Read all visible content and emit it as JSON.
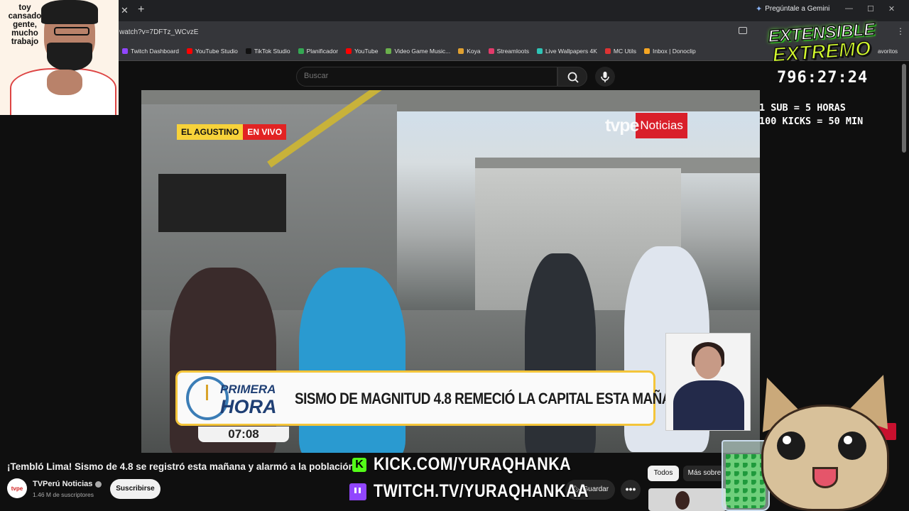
{
  "browser": {
    "gemini_label": "Pregúntale a Gemini",
    "url": "watch?v=7DFTz_WCvzE",
    "bookmarks": [
      {
        "label": "Twitch Dashboard",
        "color": "#9146ff"
      },
      {
        "label": "YouTube Studio",
        "color": "#ff0000"
      },
      {
        "label": "TikTok Studio",
        "color": "#111111"
      },
      {
        "label": "Planificador",
        "color": "#34a853"
      },
      {
        "label": "YouTube",
        "color": "#ff0000"
      },
      {
        "label": "Video Game Music...",
        "color": "#6ab04c"
      },
      {
        "label": "Koya",
        "color": "#e0a030"
      },
      {
        "label": "Streamloots",
        "color": "#e23a6a"
      },
      {
        "label": "Live Wallpapers 4K",
        "color": "#2ec4b6"
      },
      {
        "label": "MC Utils",
        "color": "#d33"
      },
      {
        "label": "Inbox | Donoclip",
        "color": "#f5a623"
      }
    ],
    "bookmarks_more": "avoritos"
  },
  "youtube": {
    "search_placeholder": "Buscar",
    "video_title": "¡Tembló Lima! Sismo de 4.8 se registró esta mañana y alarmó a la población",
    "channel_name": "TVPerú Noticias",
    "channel_avatar_text": "tvpe",
    "channel_subs": "1.46 M de suscriptores",
    "subscribe_label": "Suscribirse",
    "save_label": "Guardar",
    "more_label": "•••",
    "chips": [
      "Todos",
      "Más sobre"
    ]
  },
  "video_overlay": {
    "location": "EL AGUSTINO",
    "live": "EN VIVO",
    "brand_a": "tvpe",
    "brand_b": "Noticias",
    "program_line1": "PRIMERA",
    "program_line2": "HORA",
    "headline": "SISMO DE MAGNITUD 4.8 REMECIÓ LA CAPITAL ESTA MAÑANA",
    "time": "07:08"
  },
  "stream_overlay": {
    "facecam_text": "toy\ncansado\ngente,\nmucho\ntrabajo",
    "logo_line1": "EXTENSIBLE",
    "logo_line2": "EXTREMO",
    "timer": "796:27:24",
    "rate_subs": "1 SUB = 5 HORAS",
    "rate_kicks": "100 KICKS = 50 MIN",
    "kick_url": "KICK.COM/YURAQHANKA",
    "twitch_url": "TWITCH.TV/YURAQHANKAA"
  }
}
